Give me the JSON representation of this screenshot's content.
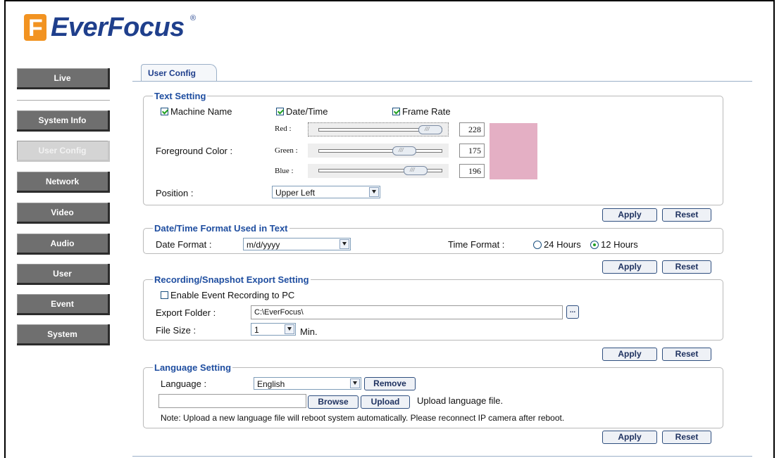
{
  "brand": {
    "name": "EverFocus",
    "reg": "®"
  },
  "sidebar": {
    "items": [
      {
        "label": "Live"
      },
      {
        "label": "System Info"
      },
      {
        "label": "User Config"
      },
      {
        "label": "Network"
      },
      {
        "label": "Video"
      },
      {
        "label": "Audio"
      },
      {
        "label": "User"
      },
      {
        "label": "Event"
      },
      {
        "label": "System"
      }
    ],
    "active": "User Config"
  },
  "tab": {
    "label": "User Config"
  },
  "text_setting": {
    "legend": "Text Setting",
    "machine_name": {
      "label": "Machine Name",
      "checked": true
    },
    "date_time": {
      "label": "Date/Time",
      "checked": true
    },
    "frame_rate": {
      "label": "Frame Rate",
      "checked": true
    },
    "foreground_label": "Foreground Color :",
    "red": {
      "label": "Red :",
      "value": "228",
      "level": 0.894
    },
    "green": {
      "label": "Green :",
      "value": "175",
      "level": 0.686
    },
    "blue": {
      "label": "Blue :",
      "value": "196",
      "level": 0.769
    },
    "swatch_color": "#e4afc4",
    "position_label": "Position :",
    "position_value": "Upper Left",
    "apply": "Apply",
    "reset": "Reset"
  },
  "datetime_format": {
    "legend": "Date/Time Format Used in Text",
    "date_label": "Date Format :",
    "date_value": "m/d/yyyy",
    "time_label": "Time Format :",
    "opt_24": "24 Hours",
    "opt_12": "12 Hours",
    "selected": "12 Hours",
    "apply": "Apply",
    "reset": "Reset"
  },
  "recording": {
    "legend": "Recording/Snapshot Export Setting",
    "enable_label": "Enable Event Recording to PC",
    "enable_checked": false,
    "folder_label": "Export Folder :",
    "folder_value": "C:\\EverFocus\\",
    "browse_glyph": "...",
    "size_label": "File Size :",
    "size_value": "1",
    "size_unit": "Min.",
    "apply": "Apply",
    "reset": "Reset"
  },
  "language": {
    "legend": "Language Setting",
    "label": "Language :",
    "value": "English",
    "remove": "Remove",
    "browse": "Browse",
    "upload": "Upload",
    "upload_hint": "Upload language file.",
    "note": "Note: Upload a new language file will reboot system automatically. Please reconnect IP camera after reboot.",
    "apply": "Apply",
    "reset": "Reset"
  }
}
